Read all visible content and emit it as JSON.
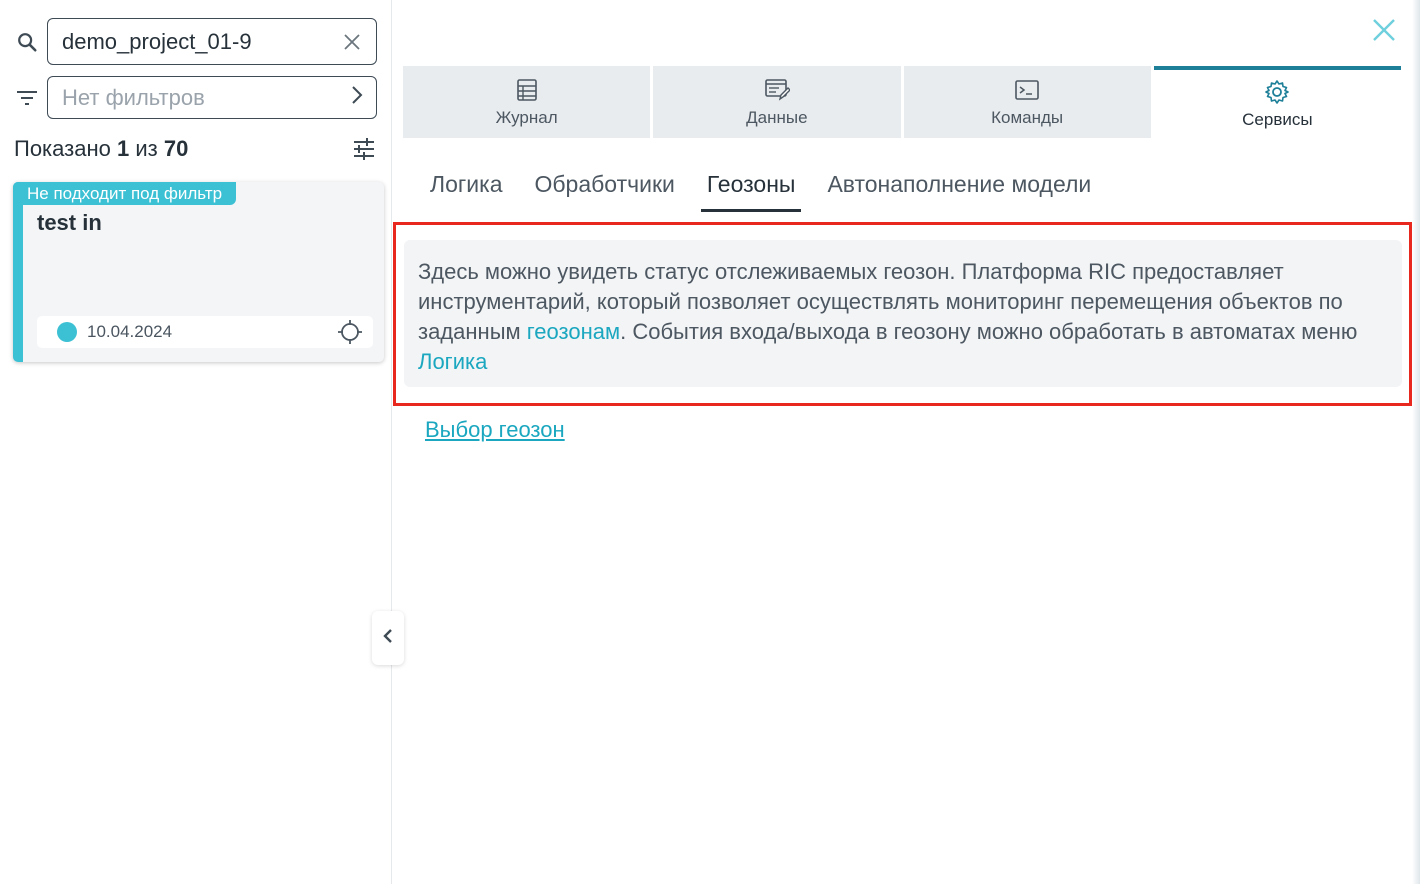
{
  "search": {
    "value": "demo_project_01-9"
  },
  "filter": {
    "placeholder": "Нет фильтров"
  },
  "count": {
    "prefix": "Показано",
    "shown": "1",
    "middle": "из",
    "total": "70"
  },
  "card": {
    "badge": "Не подходит под фильтр",
    "title": "test in",
    "date": "10.04.2024",
    "status_color": "#3cc0d4"
  },
  "top_tabs": [
    {
      "label": "Журнал",
      "icon": "journal-icon"
    },
    {
      "label": "Данные",
      "icon": "data-icon"
    },
    {
      "label": "Команды",
      "icon": "terminal-icon"
    },
    {
      "label": "Сервисы",
      "icon": "gear-icon",
      "active": true
    }
  ],
  "sub_tabs": [
    {
      "label": "Логика"
    },
    {
      "label": "Обработчики"
    },
    {
      "label": "Геозоны",
      "active": true
    },
    {
      "label": "Автонаполнение модели"
    }
  ],
  "info": {
    "text1": "Здесь можно увидеть статус отслеживаемых геозон. Платформа RIC предоставляет инструментарий, который позволяет осуществлять мониторинг перемещения объектов по заданным ",
    "link1": "геозонам",
    "text2": ". События входа/выхода в геозону можно обработать в автоматах меню ",
    "link2": "Логика"
  },
  "select_geozones_link": "Выбор геозон",
  "colors": {
    "accent": "#3cc0d4",
    "link": "#1aa7bf",
    "active_tab_bar": "#1d7f98",
    "highlight": "#e8281e"
  }
}
